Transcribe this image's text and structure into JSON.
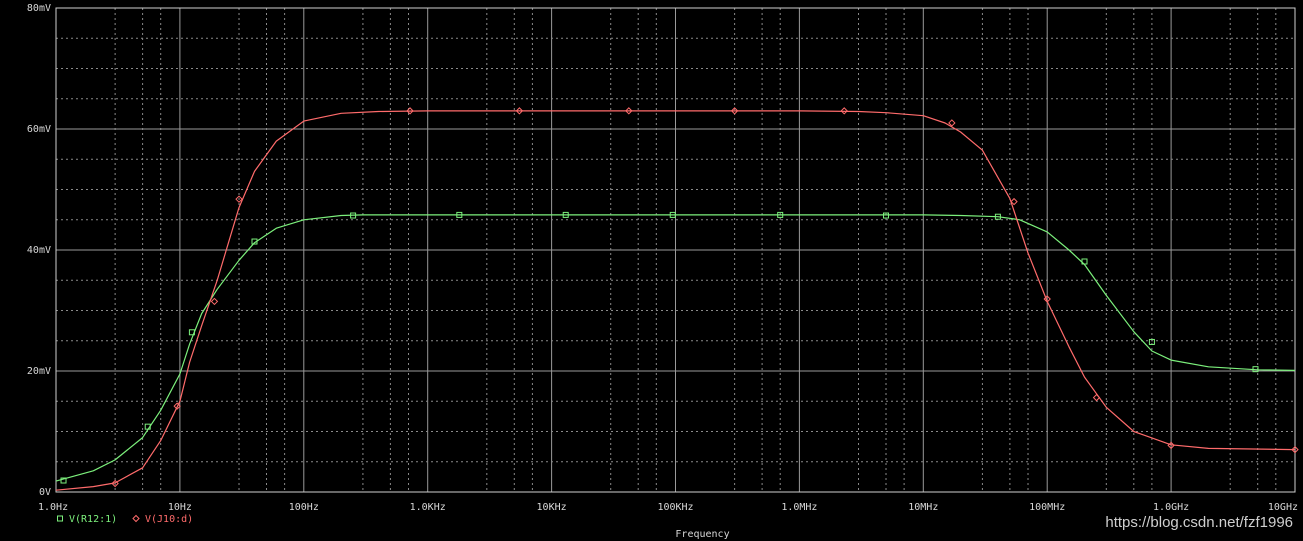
{
  "chart_data": {
    "type": "line",
    "xlabel": "Frequency",
    "x_scale": "log",
    "xlim": [
      1,
      10000000000
    ],
    "ylim": [
      0,
      80
    ],
    "grid": true,
    "x_ticks": [
      {
        "value": 1,
        "label": "1.0Hz"
      },
      {
        "value": 10,
        "label": "10Hz"
      },
      {
        "value": 100,
        "label": "100Hz"
      },
      {
        "value": 1000,
        "label": "1.0KHz"
      },
      {
        "value": 10000,
        "label": "10KHz"
      },
      {
        "value": 100000,
        "label": "100KHz"
      },
      {
        "value": 1000000,
        "label": "1.0MHz"
      },
      {
        "value": 10000000,
        "label": "10MHz"
      },
      {
        "value": 100000000,
        "label": "100MHz"
      },
      {
        "value": 1000000000,
        "label": "1.0GHz"
      },
      {
        "value": 10000000000,
        "label": "10GHz"
      }
    ],
    "y_ticks": [
      {
        "value": 0,
        "label": "0V"
      },
      {
        "value": 20,
        "label": "20mV"
      },
      {
        "value": 40,
        "label": "40mV"
      },
      {
        "value": 60,
        "label": "60mV"
      },
      {
        "value": 80,
        "label": "80mV"
      }
    ],
    "series": [
      {
        "name": "V(R12:1)",
        "color": "#7CF07C",
        "marker": "square",
        "x": [
          1,
          2,
          3,
          5,
          7,
          10,
          12,
          15,
          20,
          30,
          40,
          60,
          100,
          200,
          300,
          1000,
          10000,
          100000,
          1000000,
          5000000,
          10000000,
          20000000,
          40000000,
          60000000,
          100000000,
          150000000,
          200000000,
          300000000,
          500000000,
          700000000,
          1000000000,
          2000000000,
          5000000000,
          10000000000
        ],
        "values": [
          1.8,
          3.5,
          5.3,
          9.0,
          13.5,
          19.5,
          24.5,
          29.5,
          33.5,
          38.3,
          41.2,
          43.6,
          45.0,
          45.7,
          45.8,
          45.8,
          45.8,
          45.8,
          45.8,
          45.8,
          45.8,
          45.7,
          45.5,
          45.0,
          43.0,
          40.0,
          37.6,
          32.5,
          26.5,
          23.3,
          21.8,
          20.7,
          20.2,
          20.1
        ],
        "marker_x": [
          1.15,
          5.5,
          12.5,
          40,
          250,
          1800,
          13000,
          95000,
          700000,
          5000000,
          40000000,
          200000000,
          700000000,
          4800000000
        ],
        "marker_y": [
          1.9,
          10.8,
          26.4,
          41.4,
          45.7,
          45.8,
          45.8,
          45.8,
          45.8,
          45.7,
          45.5,
          38.1,
          24.8,
          20.3
        ]
      },
      {
        "name": "V(J10:d)",
        "color": "#FF6B6B",
        "marker": "diamond",
        "x": [
          1,
          2,
          3,
          5,
          7,
          10,
          12,
          15,
          20,
          30,
          40,
          60,
          100,
          200,
          400,
          1000,
          10000,
          100000,
          1000000,
          3000000,
          5000000,
          10000000,
          15000000,
          20000000,
          30000000,
          50000000,
          70000000,
          100000000,
          150000000,
          200000000,
          300000000,
          500000000,
          1000000000,
          2000000000,
          10000000000
        ],
        "values": [
          0.3,
          0.9,
          1.5,
          4.0,
          8.5,
          15.0,
          21.5,
          27.5,
          35.0,
          47.0,
          53.0,
          58.0,
          61.3,
          62.6,
          62.9,
          63.0,
          63.0,
          63.0,
          63.0,
          62.9,
          62.7,
          62.2,
          61.0,
          59.5,
          56.5,
          48.5,
          39.5,
          31.5,
          24.0,
          19.0,
          14.0,
          10.0,
          7.8,
          7.2,
          7.0
        ],
        "marker_x": [
          3,
          9.5,
          19,
          30,
          720,
          5500,
          42000,
          300000,
          2300000,
          17000000,
          54000000,
          100000000,
          250000000,
          1000000000,
          10000000000
        ],
        "marker_y": [
          1.4,
          14.2,
          31.5,
          48.4,
          63.0,
          63.0,
          63.0,
          63.0,
          63.0,
          61.0,
          48.0,
          31.9,
          15.6,
          7.7,
          7.0
        ]
      }
    ]
  },
  "watermark": "https://blog.csdn.net/fzf1996"
}
